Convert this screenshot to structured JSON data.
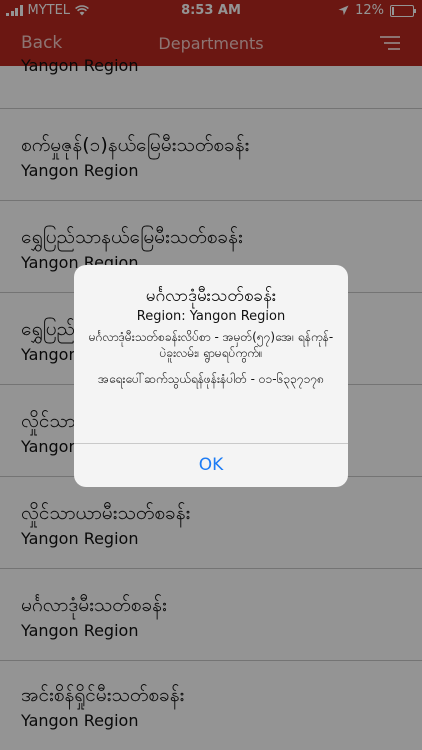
{
  "status_bar": {
    "carrier": "MYTEL",
    "time": "8:53 AM",
    "battery_percent": "12%",
    "battery_level": 0.12
  },
  "nav": {
    "back_label": "Back",
    "title": "Departments"
  },
  "departments": [
    {
      "name": "",
      "region": "Yangon Region"
    },
    {
      "name": "စက်မှုဇုန်(၁)နယ်မြေမီးသတ်စခန်း",
      "region": "Yangon Region"
    },
    {
      "name": "ရွှေပြည်သာနယ်မြေမီးသတ်စခန်း",
      "region": "Yangon Region"
    },
    {
      "name": "ရွှေပြည်သာ",
      "region": "Yangon Region"
    },
    {
      "name": "လှိုင်သာ",
      "region": "Yangon Region"
    },
    {
      "name": "လှိုင်သာယာမီးသတ်စခန်း",
      "region": "Yangon Region"
    },
    {
      "name": "မင်္ဂလာဒုံမီးသတ်စခန်း",
      "region": "Yangon Region"
    },
    {
      "name": "အင်းစိန်ရှိုင်မီးသတ်စခန်း",
      "region": "Yangon Region"
    }
  ],
  "alert": {
    "title": "မင်္ဂလာဒုံမီးသတ်စခန်း",
    "region_line": "Region: Yangon Region",
    "address_line": "မင်္ဂလာဒုံမီးသတ်စခန်းလိပ်စာ - အမှတ်(၅၇)အေ၊ ရန်ကုန်-ပဲခူးလမ်း၊ ရွာမရပ်ကွက်။",
    "phone_line": "အရေးပေါ်ဆက်သွယ်ရန်ဖုန်းနံပါတ် - ၀၁-၆၃၃၇၁၇၈",
    "ok_label": "OK"
  }
}
